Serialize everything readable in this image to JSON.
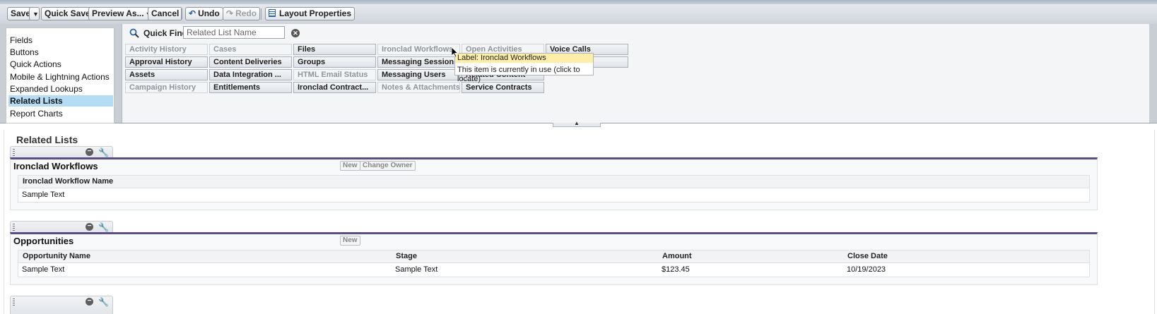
{
  "toolbar": {
    "save": "Save",
    "quick_save": "Quick Save",
    "preview_as": "Preview As...",
    "cancel": "Cancel",
    "undo": "Undo",
    "redo": "Redo",
    "layout_properties": "Layout Properties"
  },
  "sidebar": {
    "items": [
      "Fields",
      "Buttons",
      "Quick Actions",
      "Mobile & Lightning Actions",
      "Expanded Lookups",
      "Related Lists",
      "Report Charts"
    ],
    "selected": "Related Lists"
  },
  "quick_find": {
    "label": "Quick Find",
    "placeholder": "Related List Name"
  },
  "palette": {
    "tiles": [
      {
        "label": "Activity History",
        "in_use": true
      },
      {
        "label": "Cases",
        "in_use": true
      },
      {
        "label": "Files",
        "in_use": false
      },
      {
        "label": "Ironclad Workflows",
        "in_use": true
      },
      {
        "label": "Open Activities",
        "in_use": true
      },
      {
        "label": "Voice Calls",
        "in_use": false
      },
      {
        "label": "Approval History",
        "in_use": false
      },
      {
        "label": "Content Deliveries",
        "in_use": false
      },
      {
        "label": "Groups",
        "in_use": false
      },
      {
        "label": "Messaging Sessions",
        "in_use": false
      },
      {
        "label": "s",
        "in_use": false
      },
      {
        "label": "Assets",
        "in_use": false
      },
      {
        "label": "Data Integration ...",
        "in_use": false
      },
      {
        "label": "HTML Email Status",
        "in_use": true
      },
      {
        "label": "Messaging Users",
        "in_use": false
      },
      {
        "label": "Related Content",
        "in_use": false
      },
      {
        "label": "Campaign History",
        "in_use": true
      },
      {
        "label": "Entitlements",
        "in_use": false
      },
      {
        "label": "Ironclad Contract...",
        "in_use": false
      },
      {
        "label": "Notes & Attachments",
        "in_use": true
      },
      {
        "label": "Service Contracts",
        "in_use": false
      }
    ]
  },
  "tooltip": {
    "label": "Label: Ironclad Workflows",
    "body": "This item is currently in use (click to locate)"
  },
  "layout": {
    "section_title": "Related Lists",
    "related_lists": [
      {
        "title": "Ironclad Workflows",
        "buttons": [
          "New",
          "Change Owner"
        ],
        "columns": [
          "Ironclad Workflow Name"
        ],
        "row": [
          "Sample Text"
        ]
      },
      {
        "title": "Opportunities",
        "buttons": [
          "New"
        ],
        "columns": [
          "Opportunity Name",
          "Stage",
          "Amount",
          "Close Date"
        ],
        "row": [
          "Sample Text",
          "Sample Text",
          "$123.45",
          "10/19/2023"
        ]
      }
    ]
  }
}
